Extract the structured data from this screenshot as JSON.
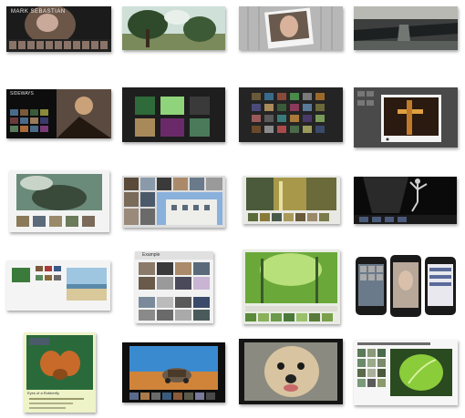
{
  "thumbnails": [
    {
      "id": "mark-sebastian",
      "title": "MARK SEBASTIAN"
    },
    {
      "id": "trees-light"
    },
    {
      "id": "polaroid-portrait"
    },
    {
      "id": "bridge-river"
    },
    {
      "id": "sideways",
      "title": "SIDEWAYS"
    },
    {
      "id": "dark-grid-green"
    },
    {
      "id": "dark-grid-thumbs"
    },
    {
      "id": "lightbox-tower"
    },
    {
      "id": "fantasy-scene"
    },
    {
      "id": "mosaic-building"
    },
    {
      "id": "forest-strip"
    },
    {
      "id": "dark-dancer"
    },
    {
      "id": "minimal-beach"
    },
    {
      "id": "example-panel",
      "title": "Example"
    },
    {
      "id": "green-forest"
    },
    {
      "id": "iphones"
    },
    {
      "id": "fly-macro",
      "caption": "Eyes of a Robberfly"
    },
    {
      "id": "desert-car"
    },
    {
      "id": "dog-closeup"
    },
    {
      "id": "green-leaf"
    }
  ]
}
